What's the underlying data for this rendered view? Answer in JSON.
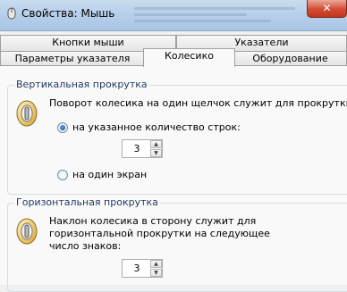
{
  "window": {
    "title": "Свойства: Мышь",
    "close_label": "✕",
    "icon": "mouse-icon"
  },
  "tabs": {
    "back_row": [
      "Кнопки мыши",
      "Указатели"
    ],
    "front_row": [
      "Параметры указателя",
      "Колесико",
      "Оборудование"
    ],
    "active": "Колесико"
  },
  "vertical": {
    "title": "Вертикальная прокрутка",
    "description": "Поворот колесика на один щелчок служит для прокрутки:",
    "option_lines": "на указанное количество строк:",
    "lines_value": "3",
    "option_screen": "на один экран",
    "selected": "option_lines"
  },
  "horizontal": {
    "title": "Горизонтальная прокрутка",
    "description_line1": "Наклон колесика в сторону служит для",
    "description_line2": "горизонтальной прокрутки на следующее",
    "description_line3": "число знаков:",
    "chars_value": "3"
  },
  "colors": {
    "group_title": "#1e395b",
    "titlebar": "#b7d0ea",
    "close": "#d34b33"
  }
}
